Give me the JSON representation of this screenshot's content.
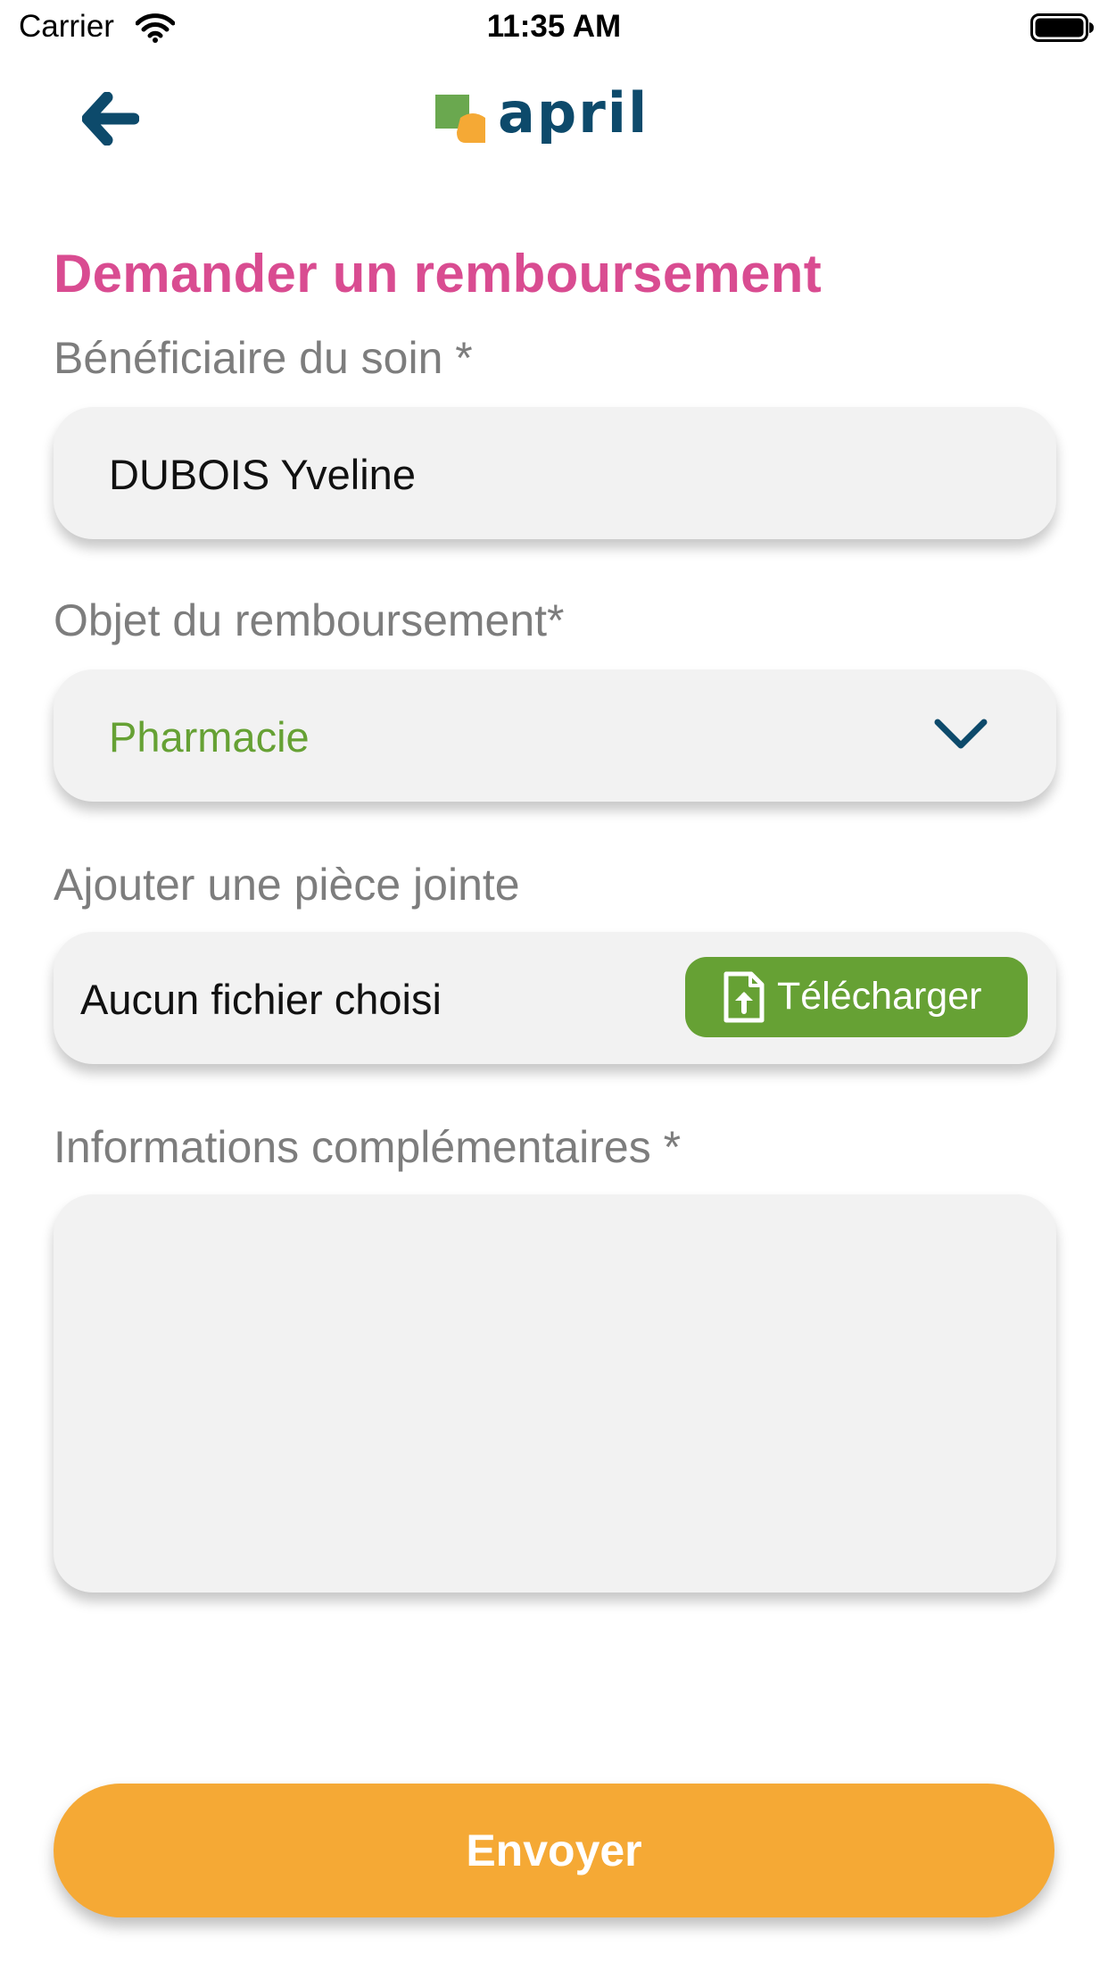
{
  "status_bar": {
    "carrier": "Carrier",
    "time": "11:35 AM",
    "icons": [
      "wifi-icon",
      "battery-icon"
    ]
  },
  "nav": {
    "back_icon": "arrow-left-icon",
    "logo_text": "april",
    "colors": {
      "primary": "#0d4a6b",
      "leaf_green": "#6aa84f",
      "leaf_orange": "#f5a935"
    }
  },
  "form": {
    "title": "Demander un remboursement",
    "beneficiary": {
      "label": "Bénéficiaire du soin *",
      "value": "DUBOIS Yveline"
    },
    "object": {
      "label": "Objet du remboursement*",
      "selected": "Pharmacie",
      "icon": "chevron-down-icon"
    },
    "attachment": {
      "label": "Ajouter une pièce jointe",
      "status": "Aucun fichier choisi",
      "button_label": "Télécharger",
      "button_icon": "file-upload-icon"
    },
    "info": {
      "label": "Informations complémentaires *",
      "value": ""
    },
    "submit_label": "Envoyer"
  },
  "colors": {
    "title_pink": "#d94c91",
    "label_gray": "#7d7d7d",
    "field_bg": "#f2f2f2",
    "selected_green": "#66a134",
    "upload_green": "#66a134",
    "submit_orange": "#f5a935"
  }
}
